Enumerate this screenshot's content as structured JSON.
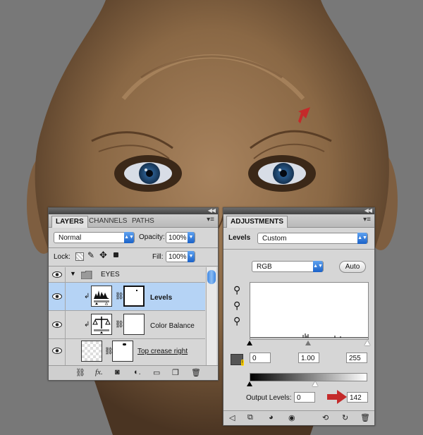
{
  "layers_panel": {
    "tabs": [
      "LAYERS",
      "CHANNELS",
      "PATHS"
    ],
    "blend_mode": "Normal",
    "opacity_label": "Opacity:",
    "opacity_value": "100%",
    "lock_label": "Lock:",
    "fill_label": "Fill:",
    "fill_value": "100%",
    "group_name": "EYES",
    "layers": [
      {
        "name": "Levels",
        "selected": true
      },
      {
        "name": "Color Balance",
        "selected": false
      },
      {
        "name": "Top crease right",
        "selected": false
      }
    ]
  },
  "adjustments_panel": {
    "tab": "ADJUSTMENTS",
    "adjustment_label": "Levels",
    "preset": "Custom",
    "channel": "RGB",
    "auto_label": "Auto",
    "input_black": "0",
    "input_gamma": "1.00",
    "input_white": "255",
    "output_label": "Output Levels:",
    "output_black": "0",
    "output_white": "142"
  },
  "colors": {
    "selection_blue": "#b5d3f5",
    "accent_blue": "#1b62c8",
    "arrow_red": "#c42a2a"
  }
}
